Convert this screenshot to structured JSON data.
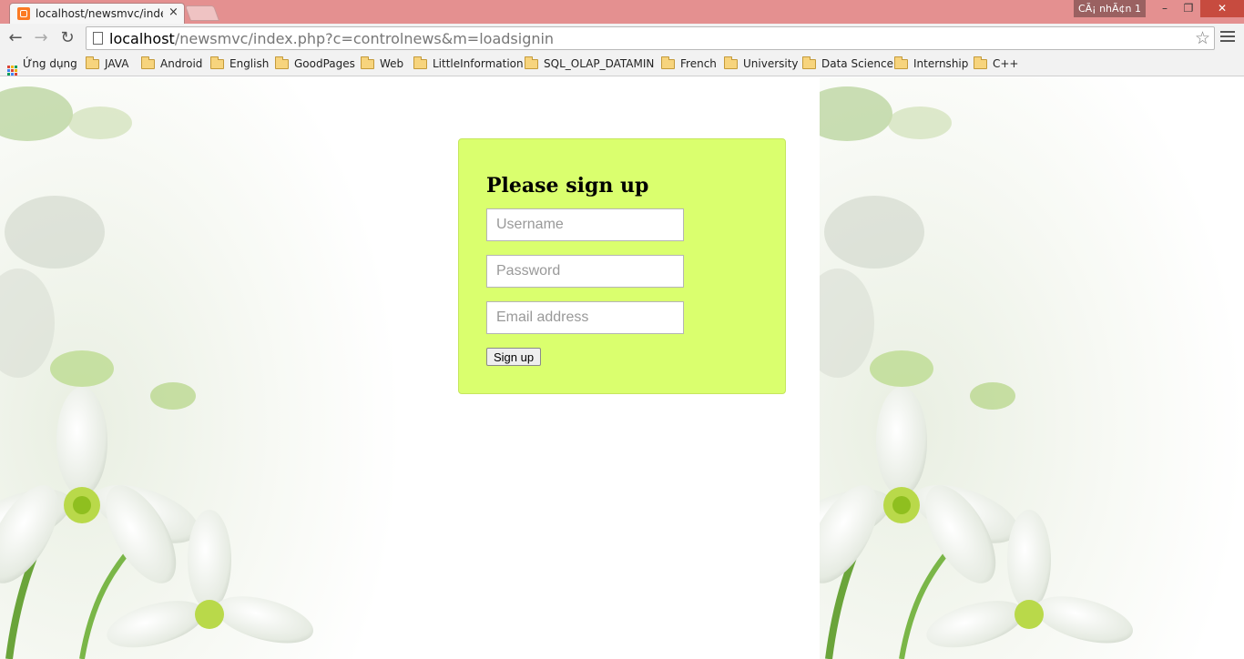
{
  "browser": {
    "tab_title": "localhost/newsmvc/index.",
    "tab_close": "×",
    "profile_name": "CÃ¡ nhÃ¢n 1",
    "window_controls": {
      "minimize": "–",
      "maximize": "❐",
      "close": "✕"
    },
    "nav": {
      "back": "←",
      "forward": "→",
      "reload": "↻"
    },
    "url_host": "localhost",
    "url_path": "/newsmvc/index.php?c=controlnews&m=loadsignin",
    "star": "☆"
  },
  "bookmarks": [
    {
      "label": "Ứng dụng",
      "icon": "apps-icon"
    },
    {
      "label": "JAVA",
      "icon": "folder-icon"
    },
    {
      "label": "Android",
      "icon": "folder-icon"
    },
    {
      "label": "English",
      "icon": "folder-icon"
    },
    {
      "label": "GoodPages",
      "icon": "folder-icon"
    },
    {
      "label": "Web",
      "icon": "folder-icon"
    },
    {
      "label": "LittleInformation",
      "icon": "folder-icon"
    },
    {
      "label": "SQL_OLAP_DATAMIN",
      "icon": "folder-icon"
    },
    {
      "label": "French",
      "icon": "folder-icon"
    },
    {
      "label": "University",
      "icon": "folder-icon"
    },
    {
      "label": "Data Science",
      "icon": "folder-icon"
    },
    {
      "label": "Internship",
      "icon": "folder-icon"
    },
    {
      "label": "C++",
      "icon": "folder-icon"
    }
  ],
  "form": {
    "title": "Please sign up",
    "username_placeholder": "Username",
    "password_placeholder": "Password",
    "email_placeholder": "Email address",
    "submit_label": "Sign up"
  },
  "colors": {
    "titlebar": "#e49090",
    "form_background": "#daff6e",
    "close_button": "#c74b3f"
  }
}
